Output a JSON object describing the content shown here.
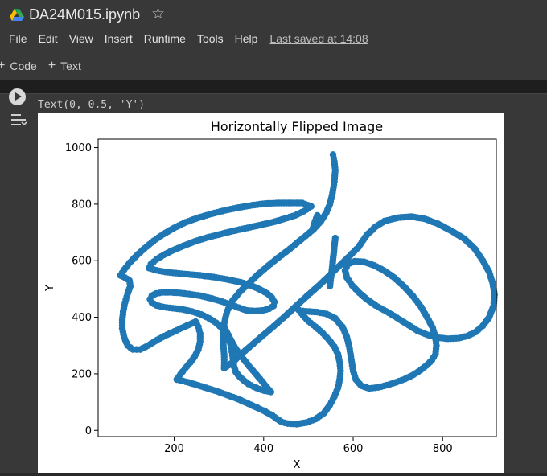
{
  "titlebar": {
    "doc_title": "DA24M015.ipynb",
    "icons": {
      "drive": "google-drive-icon",
      "star": "star-icon"
    }
  },
  "menubar": {
    "items": [
      "File",
      "Edit",
      "View",
      "Insert",
      "Runtime",
      "Tools",
      "Help"
    ],
    "last_saved": "Last saved at 14:08"
  },
  "toolbar": {
    "code_label": "Code",
    "text_label": "Text"
  },
  "cell": {
    "output_text": "Text(0, 0.5, 'Y')"
  },
  "colors": {
    "background": "#383838",
    "point_color": "#1f77b4",
    "axes_color": "#000000"
  },
  "chart_data": {
    "type": "scatter",
    "title": "Horizontally Flipped Image",
    "xlabel": "X",
    "ylabel": "Y",
    "xlim": [
      30,
      920
    ],
    "ylim": [
      -22,
      1030
    ],
    "xticks": [
      200,
      400,
      600,
      800
    ],
    "yticks": [
      0,
      200,
      400,
      600,
      800,
      1000
    ],
    "grid": false,
    "legend": "none",
    "series": [
      {
        "values": [
          [
            555,
            975
          ],
          [
            558,
            950
          ],
          [
            560,
            920
          ],
          [
            558,
            880
          ],
          [
            554,
            840
          ],
          [
            548,
            800
          ],
          [
            540,
            770
          ],
          [
            528,
            740
          ],
          [
            512,
            712
          ],
          [
            494,
            688
          ],
          [
            474,
            662
          ],
          [
            454,
            636
          ],
          [
            432,
            610
          ],
          [
            410,
            582
          ],
          [
            388,
            552
          ],
          [
            368,
            522
          ],
          [
            348,
            492
          ],
          [
            330,
            458
          ],
          [
            318,
            420
          ],
          [
            312,
            380
          ],
          [
            310,
            340
          ],
          [
            310,
            300
          ],
          [
            312,
            260
          ],
          [
            312,
            220
          ]
        ]
      },
      {
        "values": [
          [
            312,
            220
          ],
          [
            330,
            240
          ],
          [
            350,
            270
          ],
          [
            372,
            300
          ],
          [
            394,
            330
          ],
          [
            418,
            362
          ],
          [
            444,
            398
          ],
          [
            470,
            436
          ],
          [
            496,
            474
          ],
          [
            522,
            510
          ],
          [
            546,
            546
          ],
          [
            568,
            580
          ],
          [
            584,
            604
          ],
          [
            598,
            626
          ],
          [
            612,
            648
          ],
          [
            630,
            690
          ],
          [
            650,
            720
          ],
          [
            670,
            740
          ],
          [
            700,
            752
          ],
          [
            730,
            756
          ],
          [
            760,
            748
          ],
          [
            790,
            730
          ],
          [
            820,
            705
          ],
          [
            848,
            678
          ],
          [
            872,
            642
          ],
          [
            890,
            600
          ],
          [
            904,
            560
          ],
          [
            912,
            520
          ],
          [
            916,
            480
          ],
          [
            914,
            440
          ],
          [
            904,
            400
          ],
          [
            890,
            370
          ],
          [
            874,
            348
          ],
          [
            856,
            334
          ],
          [
            836,
            326
          ],
          [
            812,
            324
          ],
          [
            788,
            328
          ],
          [
            766,
            338
          ],
          [
            744,
            352
          ],
          [
            724,
            372
          ],
          [
            704,
            392
          ],
          [
            686,
            410
          ],
          [
            668,
            426
          ],
          [
            650,
            442
          ]
        ]
      },
      {
        "values": [
          [
            650,
            442
          ],
          [
            632,
            462
          ],
          [
            614,
            486
          ],
          [
            598,
            512
          ],
          [
            586,
            540
          ],
          [
            582,
            565
          ],
          [
            588,
            588
          ],
          [
            604,
            598
          ],
          [
            624,
            596
          ],
          [
            646,
            584
          ],
          [
            668,
            566
          ],
          [
            692,
            540
          ],
          [
            714,
            508
          ],
          [
            734,
            474
          ],
          [
            752,
            436
          ],
          [
            766,
            398
          ],
          [
            778,
            362
          ],
          [
            784,
            330
          ],
          [
            786,
            300
          ],
          [
            784,
            270
          ],
          [
            776,
            248
          ],
          [
            764,
            230
          ],
          [
            750,
            212
          ],
          [
            734,
            196
          ],
          [
            716,
            182
          ],
          [
            696,
            170
          ],
          [
            676,
            160
          ],
          [
            656,
            152
          ],
          [
            636,
            148
          ]
        ]
      },
      {
        "values": [
          [
            636,
            148
          ],
          [
            618,
            158
          ],
          [
            606,
            180
          ],
          [
            600,
            210
          ],
          [
            596,
            250
          ],
          [
            592,
            290
          ],
          [
            586,
            330
          ],
          [
            576,
            366
          ],
          [
            560,
            396
          ],
          [
            540,
            412
          ],
          [
            520,
            418
          ],
          [
            502,
            420
          ],
          [
            488,
            422
          ],
          [
            478,
            426
          ]
        ]
      },
      {
        "values": [
          [
            478,
            426
          ],
          [
            488,
            406
          ],
          [
            500,
            386
          ],
          [
            516,
            366
          ],
          [
            532,
            344
          ],
          [
            546,
            320
          ],
          [
            558,
            296
          ],
          [
            566,
            270
          ],
          [
            570,
            240
          ],
          [
            572,
            210
          ],
          [
            570,
            180
          ],
          [
            566,
            150
          ],
          [
            558,
            120
          ],
          [
            548,
            90
          ],
          [
            534,
            60
          ],
          [
            516,
            40
          ],
          [
            496,
            28
          ],
          [
            474,
            22
          ],
          [
            454,
            24
          ],
          [
            440,
            30
          ],
          [
            430,
            40
          ],
          [
            420,
            52
          ],
          [
            404,
            66
          ],
          [
            386,
            80
          ],
          [
            366,
            94
          ],
          [
            344,
            110
          ],
          [
            320,
            124
          ],
          [
            296,
            138
          ],
          [
            272,
            150
          ],
          [
            248,
            162
          ],
          [
            226,
            172
          ],
          [
            206,
            180
          ]
        ]
      },
      {
        "values": [
          [
            206,
            180
          ],
          [
            214,
            198
          ],
          [
            224,
            218
          ],
          [
            236,
            240
          ],
          [
            246,
            262
          ],
          [
            254,
            286
          ],
          [
            258,
            314
          ],
          [
            258,
            342
          ],
          [
            254,
            366
          ],
          [
            248,
            384
          ]
        ]
      },
      {
        "values": [
          [
            248,
            384
          ],
          [
            228,
            370
          ],
          [
            206,
            354
          ],
          [
            184,
            338
          ],
          [
            162,
            320
          ],
          [
            142,
            300
          ],
          [
            124,
            286
          ],
          [
            108,
            286
          ],
          [
            96,
            300
          ],
          [
            88,
            330
          ],
          [
            84,
            360
          ],
          [
            84,
            390
          ],
          [
            86,
            420
          ],
          [
            90,
            452
          ],
          [
            96,
            484
          ],
          [
            102,
            510
          ],
          [
            100,
            530
          ],
          [
            90,
            540
          ],
          [
            80,
            548
          ]
        ]
      },
      {
        "values": [
          [
            80,
            548
          ],
          [
            88,
            568
          ],
          [
            100,
            592
          ],
          [
            116,
            618
          ],
          [
            134,
            644
          ],
          [
            154,
            670
          ],
          [
            176,
            694
          ],
          [
            200,
            716
          ],
          [
            226,
            736
          ],
          [
            254,
            752
          ],
          [
            284,
            766
          ],
          [
            314,
            778
          ],
          [
            344,
            788
          ],
          [
            374,
            796
          ],
          [
            404,
            802
          ],
          [
            434,
            804
          ],
          [
            462,
            804
          ],
          [
            486,
            804
          ],
          [
            506,
            792
          ]
        ]
      },
      {
        "values": [
          [
            506,
            792
          ],
          [
            490,
            775
          ],
          [
            470,
            760
          ],
          [
            446,
            748
          ],
          [
            420,
            736
          ],
          [
            392,
            726
          ],
          [
            364,
            716
          ],
          [
            334,
            706
          ],
          [
            304,
            694
          ],
          [
            274,
            682
          ],
          [
            246,
            668
          ],
          [
            220,
            652
          ],
          [
            196,
            636
          ],
          [
            176,
            620
          ],
          [
            160,
            604
          ],
          [
            148,
            588
          ],
          [
            144,
            574
          ]
        ]
      },
      {
        "values": [
          [
            144,
            574
          ],
          [
            160,
            566
          ],
          [
            180,
            560
          ],
          [
            204,
            556
          ],
          [
            230,
            552
          ],
          [
            258,
            548
          ],
          [
            288,
            542
          ],
          [
            318,
            534
          ],
          [
            348,
            524
          ],
          [
            372,
            512
          ],
          [
            392,
            498
          ],
          [
            408,
            484
          ],
          [
            418,
            470
          ],
          [
            424,
            454
          ],
          [
            422,
            440
          ],
          [
            412,
            430
          ],
          [
            398,
            424
          ],
          [
            380,
            422
          ],
          [
            362,
            424
          ]
        ]
      },
      {
        "values": [
          [
            362,
            424
          ],
          [
            344,
            434
          ],
          [
            324,
            446
          ],
          [
            302,
            458
          ],
          [
            280,
            468
          ],
          [
            258,
            476
          ],
          [
            234,
            482
          ],
          [
            212,
            486
          ],
          [
            192,
            488
          ],
          [
            174,
            488
          ],
          [
            160,
            484
          ],
          [
            150,
            476
          ],
          [
            146,
            464
          ],
          [
            150,
            452
          ],
          [
            160,
            442
          ],
          [
            176,
            436
          ],
          [
            196,
            432
          ],
          [
            218,
            428
          ],
          [
            240,
            420
          ],
          [
            260,
            410
          ],
          [
            278,
            396
          ],
          [
            294,
            380
          ],
          [
            306,
            362
          ],
          [
            316,
            340
          ],
          [
            324,
            316
          ],
          [
            328,
            290
          ],
          [
            330,
            266
          ],
          [
            332,
            244
          ],
          [
            334,
            224
          ],
          [
            338,
            206
          ]
        ]
      },
      {
        "values": [
          [
            338,
            206
          ],
          [
            346,
            190
          ],
          [
            356,
            176
          ],
          [
            366,
            164
          ],
          [
            378,
            154
          ],
          [
            390,
            146
          ],
          [
            402,
            140
          ],
          [
            416,
            136
          ]
        ]
      },
      {
        "values": [
          [
            416,
            136
          ],
          [
            404,
            158
          ],
          [
            392,
            182
          ],
          [
            380,
            204
          ],
          [
            368,
            226
          ],
          [
            356,
            250
          ],
          [
            344,
            274
          ],
          [
            334,
            298
          ],
          [
            326,
            322
          ],
          [
            318,
            346
          ],
          [
            310,
            370
          ]
        ]
      },
      {
        "values": [
          [
            560,
            680
          ],
          [
            556,
            620
          ],
          [
            552,
            560
          ],
          [
            548,
            510
          ]
        ]
      },
      {
        "values": [
          [
            520,
            760
          ],
          [
            515,
            740
          ],
          [
            510,
            715
          ]
        ]
      }
    ]
  }
}
